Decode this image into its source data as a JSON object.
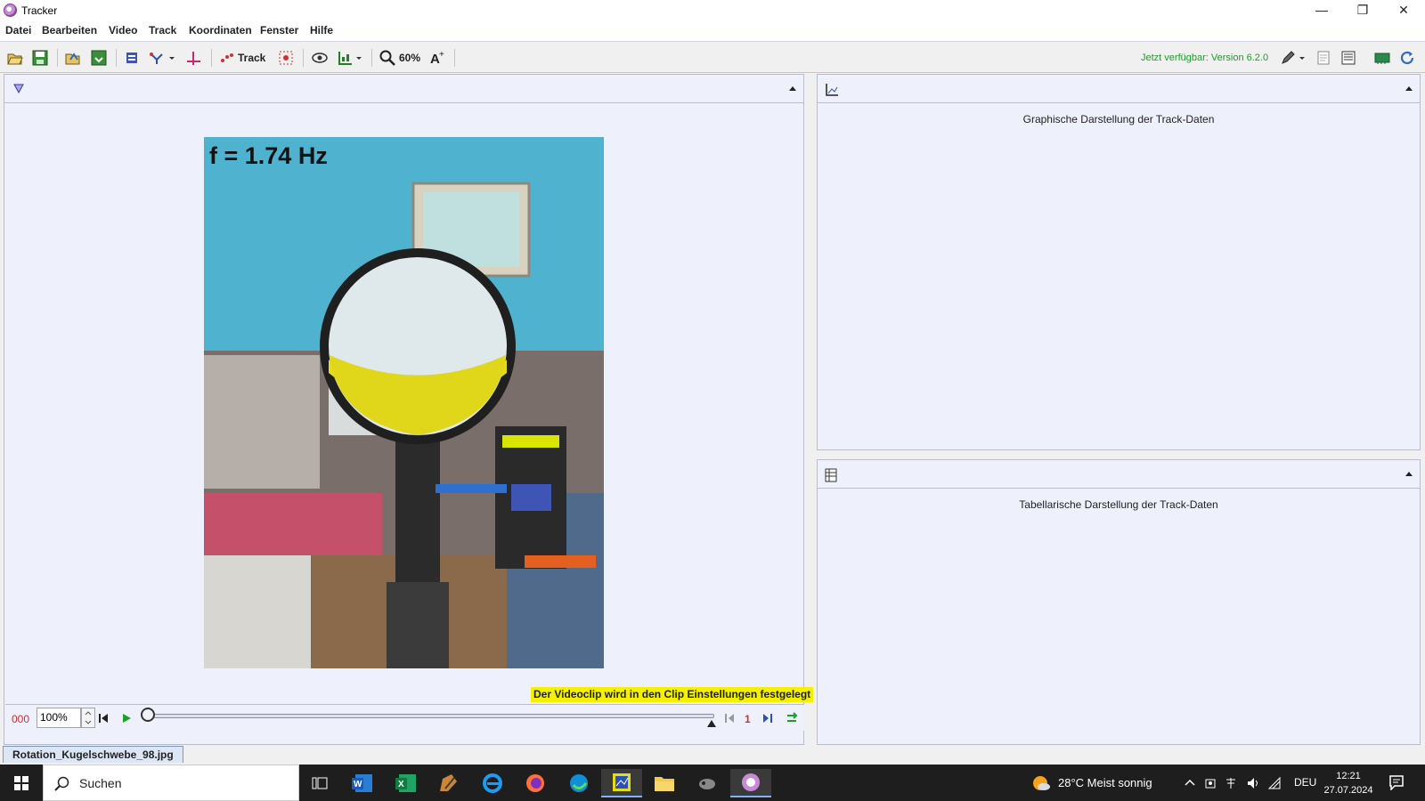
{
  "window": {
    "title": "Tracker",
    "minimize": "—",
    "maximize": "❐",
    "close": "✕"
  },
  "menu": [
    "Datei",
    "Bearbeiten",
    "Video",
    "Track",
    "Koordinaten",
    "Fenster",
    "Hilfe"
  ],
  "toolbar": {
    "track_label": "Track",
    "zoom_label": "60%",
    "update_note": "Jetzt verfügbar: Version 6.2.0"
  },
  "video": {
    "overlay_text": "f = 1.74 Hz",
    "clip_note": "Der Videoclip wird in den Clip Einstellungen festgelegt"
  },
  "player": {
    "frame_counter": "000",
    "rate": "100%",
    "frame_number": "1"
  },
  "plot_panel": {
    "caption": "Graphische Darstellung der Track-Daten"
  },
  "table_panel": {
    "caption": "Tabellarische Darstellung der Track-Daten"
  },
  "file_tab": {
    "label": "Rotation_Kugelschwebe_98.jpg"
  },
  "taskbar": {
    "search_label": "Suchen",
    "weather": "28°C  Meist sonnig",
    "language": "DEU",
    "time": "12:21",
    "date": "27.07.2024"
  },
  "colors": {
    "accent_green": "#1aa128",
    "frame_red": "#d23030",
    "panel_bg": "#eef0fc",
    "clip_note_bg": "#f4f000"
  }
}
